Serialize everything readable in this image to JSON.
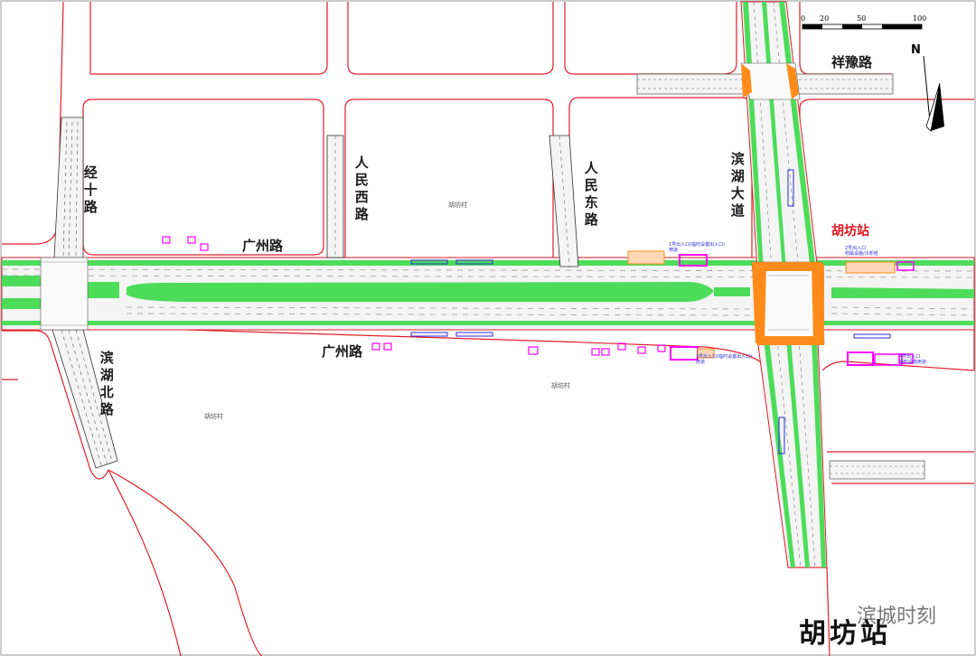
{
  "map": {
    "roads": {
      "jing_shi_lu": "经十路",
      "ren_min_xi_lu": "人民西路",
      "ren_min_dong_lu": "人民东路",
      "bin_hu_da_dao": "滨湖大道",
      "xiang_yu_lu": "祥豫路",
      "bin_hu_bei_lu": "滨湖北路",
      "guang_zhou_lu_north": "广州路",
      "guang_zhou_lu_south": "广州路"
    },
    "station": "胡坊站",
    "village_labels": [
      "胡坊村",
      "胡坊村",
      "胡坊村"
    ],
    "entrance_notes": [
      "1号出入口(临时设置出入口)\n用道",
      "2号出入口\n附属设施/冷却塔",
      "3号出入口(临时设置出入口)\n用道",
      "4号出入口\n临时设施用道"
    ],
    "scale": {
      "ticks": [
        "0",
        "20",
        "50",
        "100"
      ]
    },
    "north_label": "N"
  },
  "overlay": {
    "watermark": "滨城时刻",
    "title": "胡坊站"
  },
  "colors": {
    "road_outline": "#e01e2a",
    "median_green": "#4ddc5a",
    "intersection_orange": "#ff8c1a",
    "facility_magenta": "#ff00ff",
    "station_red": "#e0141e",
    "note_blue": "#2d2ad8"
  }
}
